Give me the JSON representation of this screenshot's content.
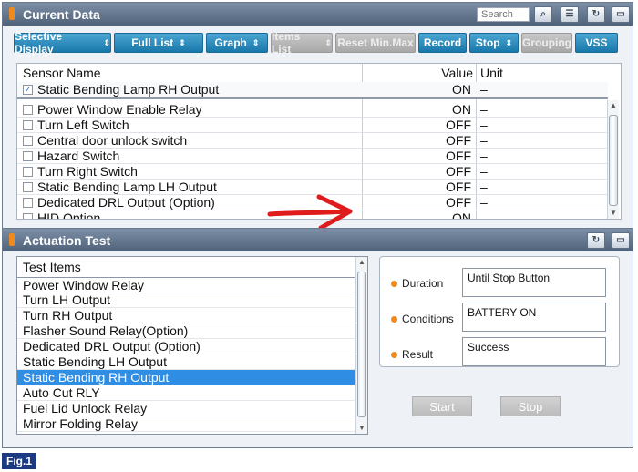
{
  "current_data": {
    "title": "Current Data",
    "search_placeholder": "Search",
    "toolbar": [
      {
        "label": "Selective Display",
        "arrow": "⇕",
        "enabled": true
      },
      {
        "label": "Full List",
        "arrow": "⇕",
        "enabled": true
      },
      {
        "label": "Graph",
        "arrow": "⇕",
        "enabled": true
      },
      {
        "label": "Items List",
        "arrow": "⇕",
        "enabled": false
      },
      {
        "label": "Reset Min.Max",
        "enabled": false
      },
      {
        "label": "Record",
        "enabled": true
      },
      {
        "label": "Stop",
        "arrow": "⇕",
        "enabled": true
      },
      {
        "label": "Grouping",
        "enabled": false
      },
      {
        "label": "VSS",
        "enabled": true
      }
    ],
    "table": {
      "headers": {
        "name": "Sensor Name",
        "value": "Value",
        "unit": "Unit"
      },
      "pinned_row": {
        "name": "Static Bending Lamp RH Output",
        "value": "ON",
        "unit": "–",
        "checked": true
      },
      "rows": [
        {
          "name": "Power Window Enable Relay",
          "value": "ON",
          "unit": "–",
          "checked": false
        },
        {
          "name": "Turn Left Switch",
          "value": "OFF",
          "unit": "–",
          "checked": false
        },
        {
          "name": "Central door unlock switch",
          "value": "OFF",
          "unit": "–",
          "checked": false
        },
        {
          "name": "Hazard Switch",
          "value": "OFF",
          "unit": "–",
          "checked": false
        },
        {
          "name": "Turn Right Switch",
          "value": "OFF",
          "unit": "–",
          "checked": false
        },
        {
          "name": "Static Bending Lamp LH Output",
          "value": "OFF",
          "unit": "–",
          "checked": false
        },
        {
          "name": "Dedicated DRL Output (Option)",
          "value": "OFF",
          "unit": "–",
          "checked": false
        },
        {
          "name": "HID Option",
          "value": "ON",
          "unit": "–",
          "checked": false
        }
      ]
    }
  },
  "actuation_test": {
    "title": "Actuation Test",
    "list_header": "Test Items",
    "items": [
      "Power Window Relay",
      "Turn LH Output",
      "Turn RH Output",
      "Flasher Sound Relay(Option)",
      "Dedicated DRL Output (Option)",
      "Static Bending LH Output",
      "Static Bending RH Output",
      "Auto Cut RLY",
      "Fuel Lid Unlock Relay",
      "Mirror Folding Relay"
    ],
    "selected_item": "Static Bending RH Output",
    "duration_label": "Duration",
    "duration_value": "Until Stop Button",
    "conditions_label": "Conditions",
    "conditions_value": "BATTERY ON",
    "result_label": "Result",
    "result_value": "Success",
    "start_label": "Start",
    "stop_label": "Stop"
  },
  "figure_label": "Fig.1",
  "colors": {
    "accent": "#1978aa",
    "title_bar": "#5b6e86",
    "selection": "#2f8ee3",
    "arrow": "#e01b1b"
  }
}
